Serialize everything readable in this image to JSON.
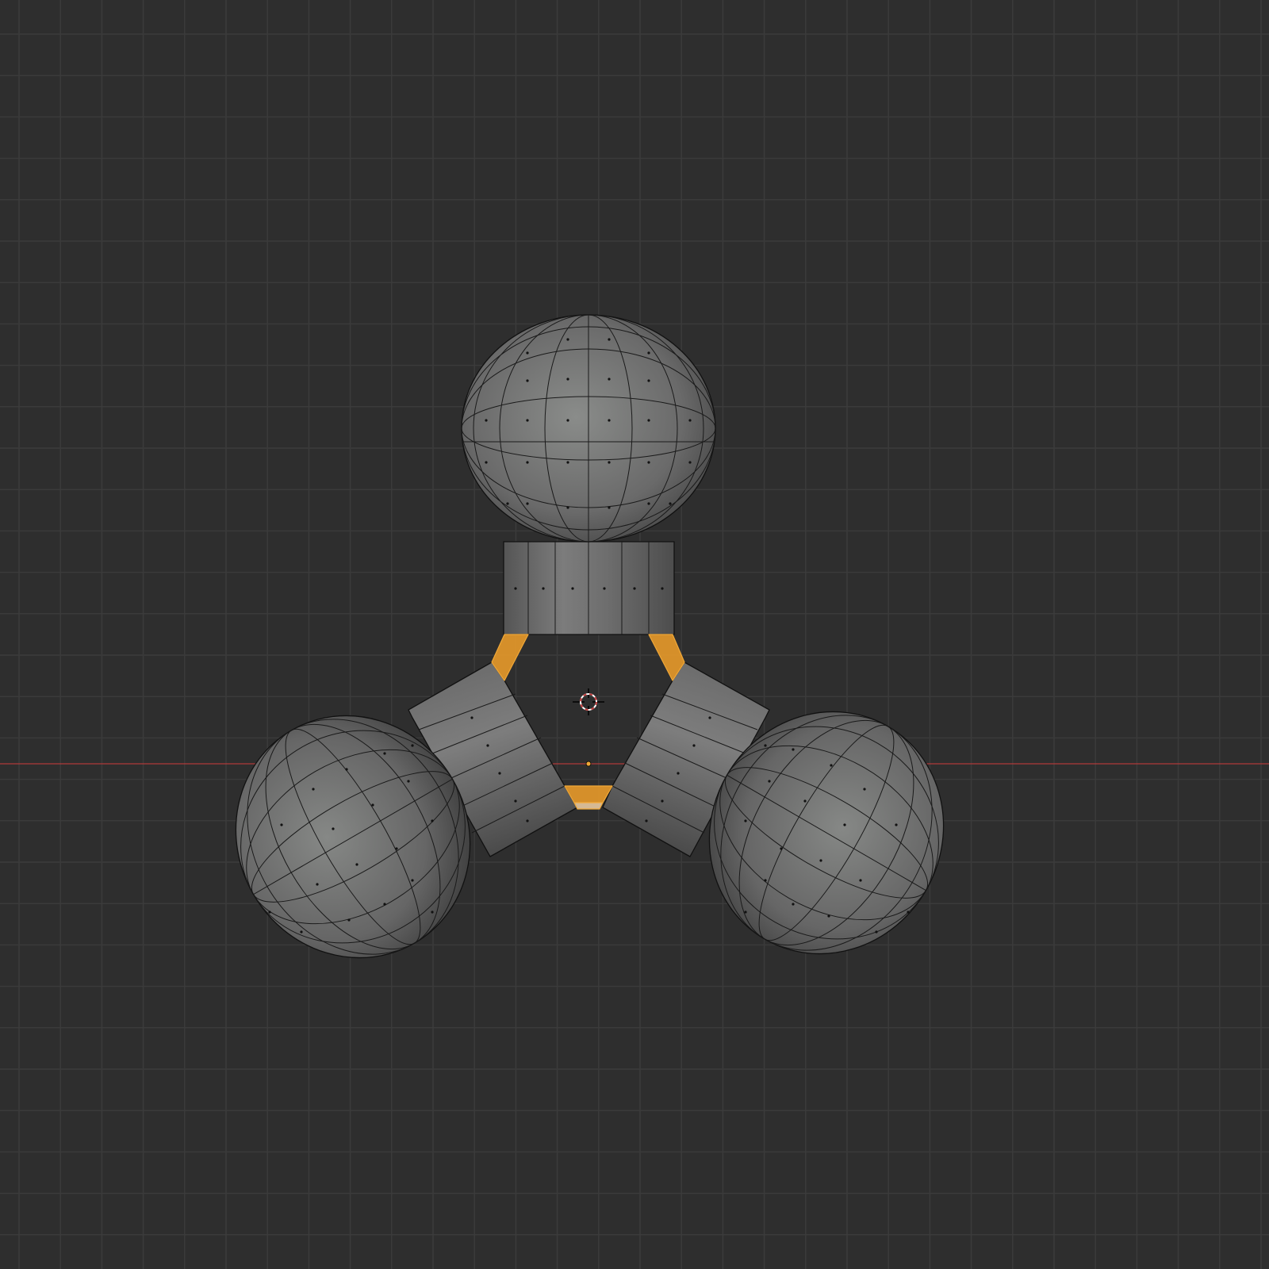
{
  "viewport": {
    "mode": "edit-mode-face-select",
    "colors": {
      "background": "#2e2e2e",
      "grid_line": "#3b3b3b",
      "x_axis": "#b03a3a",
      "mesh_face": "#6e6e6e",
      "mesh_edge": "#111111",
      "selected_face": "#e89a2a",
      "cursor_red": "#c43c3c"
    },
    "icons": [
      "3d-cursor-icon",
      "origin-point-icon"
    ],
    "selected_faces": 3
  }
}
